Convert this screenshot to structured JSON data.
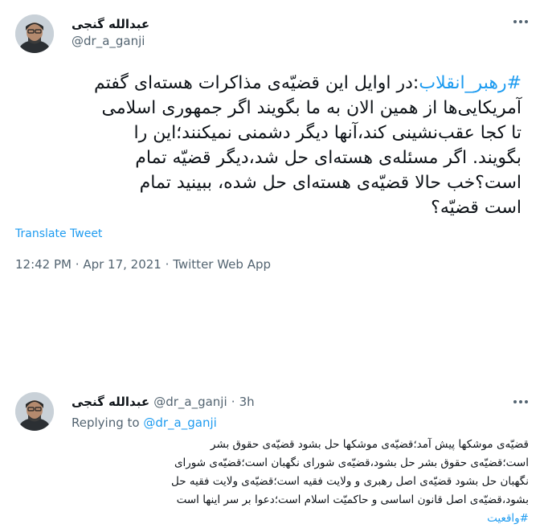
{
  "main_tweet": {
    "author_name": "عبدالله گنجی",
    "author_handle": "@dr_a_ganji",
    "more_icon": "more-dots-icon",
    "hashtag": "#رهبر_انقلاب",
    "lines": [
      ":در اوایل این قضیّه‌ی مذاکرات هسته‌ای گفتم",
      "آمریکایی‌ها از همین الان به ما بگویند اگر جمهوری اسلامی",
      "تا کجا عقب‌نشینی کند،آنها دیگر دشمنی نمیکنند؛این را",
      "بگویند. اگر مسئله‌ی هسته‌ای حل شد،دیگر قضیّه تمام",
      "است؟خب حالا قضیّه‌ی هسته‌ای حل شده، ببینید تمام",
      "است قضیّه؟"
    ],
    "translate_label": "Translate Tweet",
    "time": "12:42 PM",
    "date": "Apr 17, 2021",
    "source": "Twitter Web App",
    "separator": "·"
  },
  "reply_tweet": {
    "author_name": "عبدالله گنجی",
    "author_handle": "@dr_a_ganji",
    "separator": "·",
    "time_ago": "3h",
    "replying_prefix": "Replying to",
    "replying_handle": "@dr_a_ganji",
    "more_icon": "more-dots-icon",
    "lines": [
      "قضیّه‌ی موشکها پیش آمد؛قضیّه‌ی موشکها حل بشود قضیّه‌ی حقوق بشر",
      "است؛قضیّه‌ی حقوق بشر حل بشود،قضیّه‌ی شورای نگهبان است؛قضیّه‌ی شورای",
      "نگهبان حل بشود قضیّه‌ی اصل رهبری و ولایت فقیه است؛قضیّه‌ی ولایت فقیه حل",
      "بشود،قضیّه‌ی اصل قانون اساسی و حاکمیّت اسلام است؛دعوا بر سر اینها است"
    ],
    "hashtag": "#واقعیت"
  }
}
